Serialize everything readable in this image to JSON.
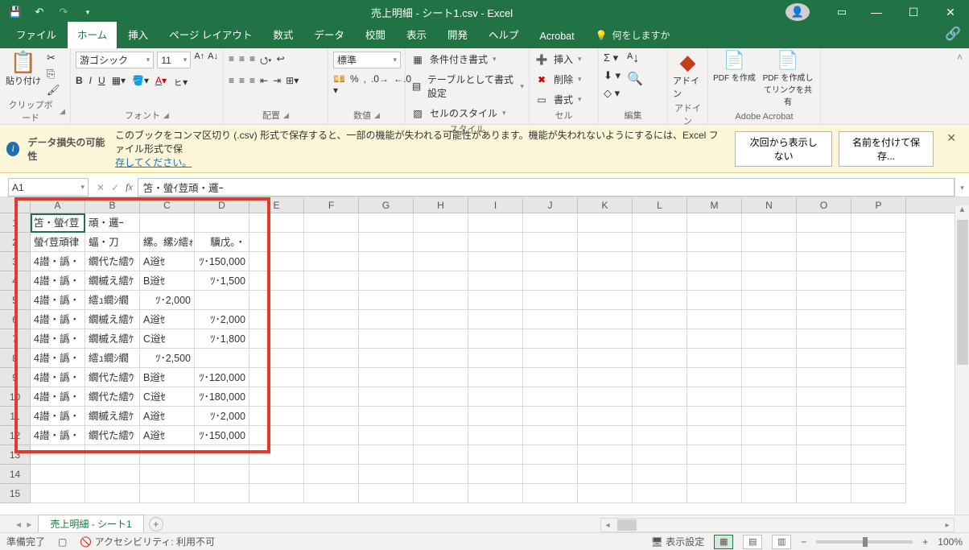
{
  "titlebar": {
    "title": "売上明細 - シート1.csv - Excel"
  },
  "ribbon_tabs": {
    "file": "ファイル",
    "home": "ホーム",
    "insert": "挿入",
    "page_layout": "ページ レイアウト",
    "formulas": "数式",
    "data": "データ",
    "review": "校閲",
    "view": "表示",
    "developer": "開発",
    "help": "ヘルプ",
    "acrobat": "Acrobat",
    "tell_me": "何をしますか"
  },
  "ribbon": {
    "clipboard": {
      "label": "クリップボード",
      "paste": "貼り付け"
    },
    "font": {
      "label": "フォント",
      "name": "游ゴシック",
      "size": "11"
    },
    "alignment": {
      "label": "配置"
    },
    "number": {
      "label": "数値",
      "format": "標準"
    },
    "styles": {
      "label": "スタイル",
      "conditional": "条件付き書式",
      "table": "テーブルとして書式設定",
      "cell": "セルのスタイル"
    },
    "cells": {
      "label": "セル",
      "insert": "挿入",
      "delete": "削除",
      "format": "書式"
    },
    "editing": {
      "label": "編集"
    },
    "addins": {
      "label": "アドイン",
      "addin": "アドイン"
    },
    "acrobat": {
      "label": "Adobe Acrobat",
      "create": "PDF を作成",
      "share": "PDF を作成してリンクを共有"
    }
  },
  "msgbar": {
    "title": "データ損失の可能性",
    "body1": "このブックをコンマ区切り (.csv) 形式で保存すると、一部の機能が失われる可能性があります。機能が失われないようにするには、Excel ファイル形式で保",
    "link": "存してください。",
    "btn1": "次回から表示しない",
    "btn2": "名前を付けて保存..."
  },
  "namebox": "A1",
  "formula": "笘・螢ｲ荳頑・邏ｰ",
  "columns": [
    "A",
    "B",
    "C",
    "D",
    "E",
    "F",
    "G",
    "H",
    "I",
    "J",
    "K",
    "L",
    "M",
    "N",
    "O",
    "P"
  ],
  "rows": [
    {
      "n": "1",
      "cells": [
        "笘・螢ｲ荳",
        "頑・邏ｰ",
        "",
        ""
      ]
    },
    {
      "n": "2",
      "cells": [
        "螢ｲ荳頑律",
        "蝠・刀",
        "縲。縲ｼ繧ｫ",
        "驥戊｡・"
      ]
    },
    {
      "n": "3",
      "cells": [
        "4譛・譌・",
        "繝代た繧ｳ",
        "A逧ｾ",
        "ﾂ･150,000"
      ]
    },
    {
      "n": "4",
      "cells": [
        "4譛・譌・",
        "繝槭え繧ｹ",
        "B逧ｾ",
        "ﾂ･1,500"
      ]
    },
    {
      "n": "5",
      "cells": [
        "4譛・譌・",
        "繧ｭ繝ｼ繝",
        "ﾂ･2,000",
        ""
      ]
    },
    {
      "n": "6",
      "cells": [
        "4譛・譌・",
        "繝槭え繧ｹ",
        "A逧ｾ",
        "ﾂ･2,000"
      ]
    },
    {
      "n": "7",
      "cells": [
        "4譛・譌・",
        "繝槭え繧ｹ",
        "C逧ｾ",
        "ﾂ･1,800"
      ]
    },
    {
      "n": "8",
      "cells": [
        "4譛・譌・",
        "繧ｭ繝ｼ繝",
        "ﾂ･2,500",
        ""
      ]
    },
    {
      "n": "9",
      "cells": [
        "4譛・譌・",
        "繝代た繧ｳ",
        "B逧ｾ",
        "ﾂ･120,000"
      ]
    },
    {
      "n": "10",
      "cells": [
        "4譛・譌・",
        "繝代た繧ｳ",
        "C逧ｾ",
        "ﾂ･180,000"
      ]
    },
    {
      "n": "11",
      "cells": [
        "4譛・譌・",
        "繝槭え繧ｹ",
        "A逧ｾ",
        "ﾂ･2,000"
      ]
    },
    {
      "n": "12",
      "cells": [
        "4譛・譌・",
        "繝代た繧ｳ",
        "A逧ｾ",
        "ﾂ･150,000"
      ]
    },
    {
      "n": "13",
      "cells": [
        "",
        "",
        "",
        ""
      ]
    },
    {
      "n": "14",
      "cells": [
        "",
        "",
        "",
        ""
      ]
    },
    {
      "n": "15",
      "cells": [
        "",
        "",
        "",
        ""
      ]
    }
  ],
  "sheet_tab": "売上明細 - シート1",
  "status": {
    "ready": "準備完了",
    "acc": "アクセシビリティ: 利用不可",
    "display": "表示設定",
    "zoom": "100%"
  }
}
